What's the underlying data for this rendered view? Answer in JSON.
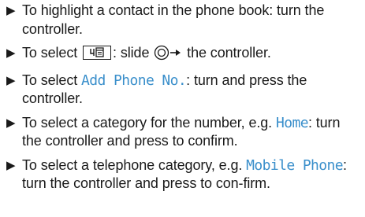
{
  "bullet_glyph": "▶",
  "steps": [
    {
      "text_a": "To highlight a contact in the phone book: turn the controller."
    },
    {
      "text_a": "To select ",
      "menu_icon": "menu-symbol-icon",
      "text_b": ": slide ",
      "controller_icon": "controller-slide-right-icon",
      "text_c": " the controller."
    },
    {
      "text_a": "To select ",
      "display_term": "Add Phone No.",
      "text_b": ": turn and press the controller."
    },
    {
      "text_a": "To select a category for the number, e.g. ",
      "display_term": "Home",
      "text_b": ": turn the controller and press to confirm."
    },
    {
      "text_a": "To select a telephone category, e.g. ",
      "display_term": "Mobile Phone",
      "text_b": ": turn the controller and press to con-firm."
    }
  ],
  "colors": {
    "display_text": "#3a8fcb",
    "body_text": "#1a1a1a"
  }
}
